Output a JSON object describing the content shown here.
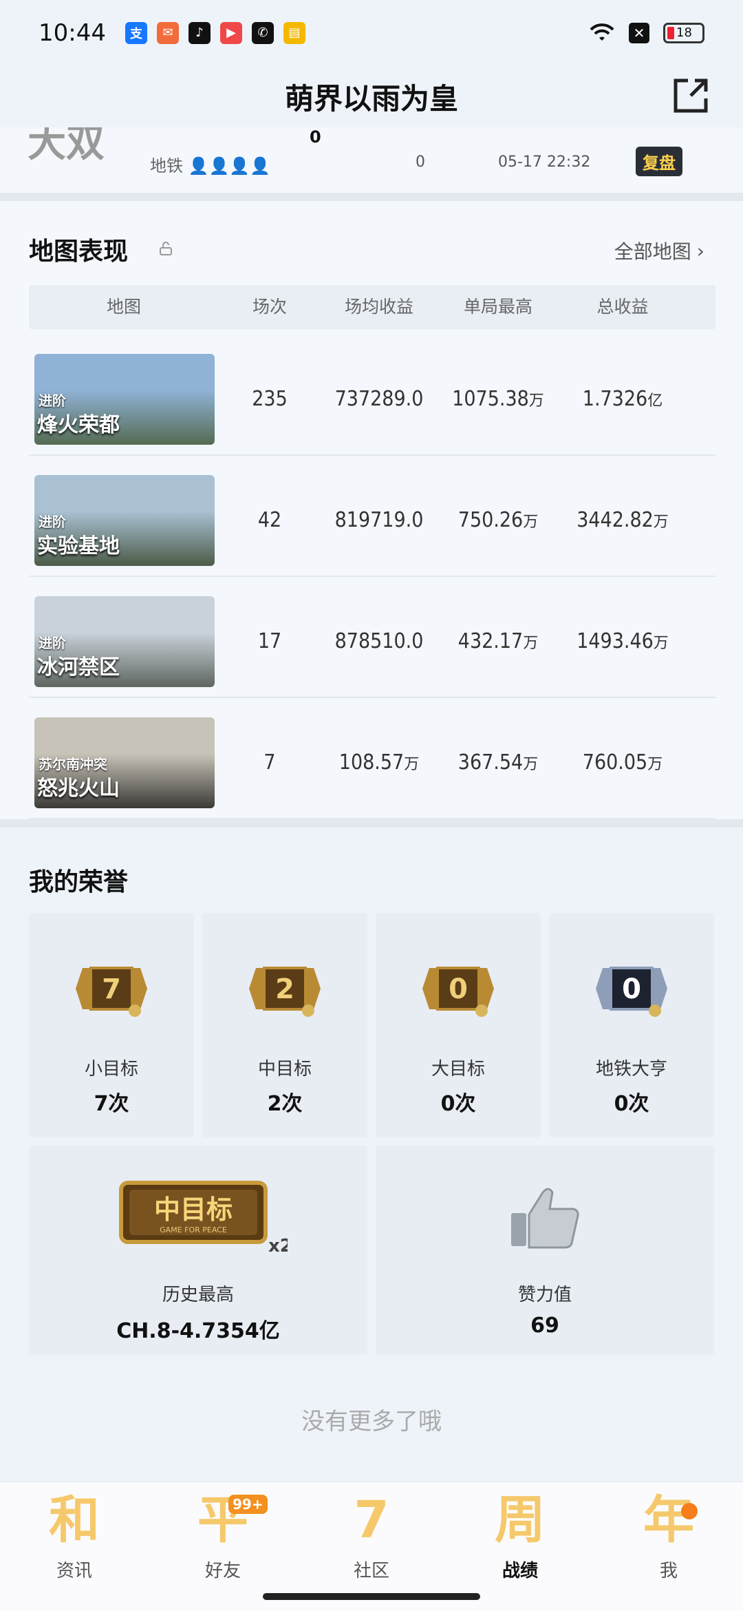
{
  "status_bar": {
    "time": "10:44",
    "battery": "18",
    "app_icons": [
      {
        "name": "alipay-icon",
        "glyph": "支",
        "color": "#1677ff"
      },
      {
        "name": "mail-icon",
        "glyph": "✉",
        "color": "#f26b3a"
      },
      {
        "name": "tiktok-icon",
        "glyph": "♪",
        "color": "#111111"
      },
      {
        "name": "video-icon",
        "glyph": "▶",
        "color": "#f04848"
      },
      {
        "name": "wechat-icon",
        "glyph": "✆",
        "color": "#111111"
      },
      {
        "name": "notes-icon",
        "glyph": "▤",
        "color": "#f5b800"
      }
    ]
  },
  "header": {
    "title": "萌界以雨为皇"
  },
  "previous_row": {
    "mode": "地铁",
    "kills": "0",
    "time": "05-17 22:32",
    "replay_label": "复盘"
  },
  "map_section": {
    "title": "地图表现",
    "all_maps_label": "全部地图",
    "columns": [
      "地图",
      "场次",
      "场均收益",
      "单局最高",
      "总收益"
    ],
    "rows": [
      {
        "tag": "进阶",
        "name": "烽火荣都",
        "matches": "235",
        "avg": "737289.0",
        "avg_unit": "",
        "best": "1075.38",
        "best_unit": "万",
        "total": "1.7326",
        "total_unit": "亿",
        "colors": [
          "#8fb2d6",
          "#556b52"
        ]
      },
      {
        "tag": "进阶",
        "name": "实验基地",
        "matches": "42",
        "avg": "819719.0",
        "avg_unit": "",
        "best": "750.26",
        "best_unit": "万",
        "total": "3442.82",
        "total_unit": "万",
        "colors": [
          "#a9c1d3",
          "#4c5b47"
        ]
      },
      {
        "tag": "进阶",
        "name": "冰河禁区",
        "matches": "17",
        "avg": "878510.0",
        "avg_unit": "",
        "best": "432.17",
        "best_unit": "万",
        "total": "1493.46",
        "total_unit": "万",
        "colors": [
          "#c9d2db",
          "#5f6660"
        ]
      },
      {
        "tag": "苏尔南冲突",
        "name": "怒兆火山",
        "matches": "7",
        "avg": "108.57",
        "avg_unit": "万",
        "best": "367.54",
        "best_unit": "万",
        "total": "760.05",
        "total_unit": "万",
        "colors": [
          "#c8c3b8",
          "#3b3a36"
        ]
      }
    ]
  },
  "honors": {
    "title": "我的荣誉",
    "small_cards": [
      {
        "badge": "7",
        "label": "小目标",
        "value": "7次",
        "dark": false
      },
      {
        "badge": "2",
        "label": "中目标",
        "value": "2次",
        "dark": false
      },
      {
        "badge": "0",
        "label": "大目标",
        "value": "0次",
        "dark": false
      },
      {
        "badge": "0",
        "label": "地铁大亨",
        "value": "0次",
        "dark": true
      }
    ],
    "history_best": {
      "badge_text": "中目标",
      "badge_sub": "GAME FOR PEACE",
      "multiplier": "x2",
      "label": "历史最高",
      "value": "CH.8-4.7354亿"
    },
    "like": {
      "label": "赞力值",
      "value": "69"
    },
    "no_more": "没有更多了哦"
  },
  "nav": [
    {
      "glyph": "和",
      "label": "资讯"
    },
    {
      "glyph": "平",
      "label": "好友",
      "badge": "99+"
    },
    {
      "glyph": "7",
      "label": "社区"
    },
    {
      "glyph": "周",
      "label": "战绩"
    },
    {
      "glyph": "年",
      "label": "我"
    }
  ]
}
